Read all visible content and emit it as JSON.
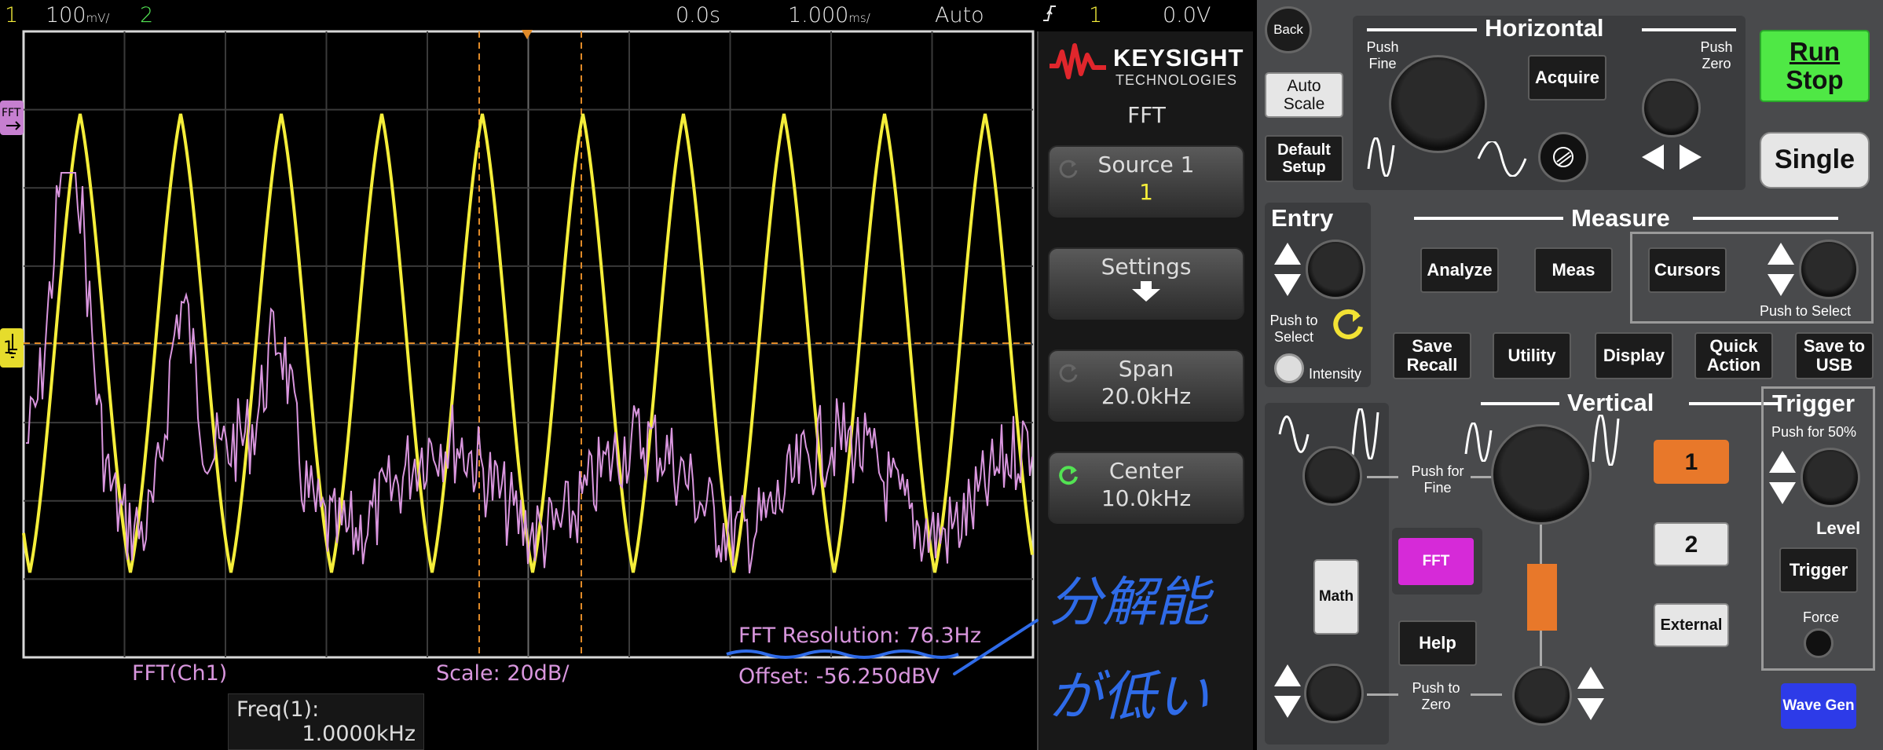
{
  "status_bar": {
    "ch1_number": "1",
    "ch1_scale": "100",
    "ch1_scale_unit": "mV/",
    "ch2_number": "2",
    "time_position": "0.0s",
    "time_scale": "1.000",
    "time_scale_unit": "ms/",
    "trigger_mode": "Auto",
    "trigger_edge_icon": "rising-edge-icon",
    "trigger_source": "1",
    "trigger_level": "0.0V"
  },
  "display": {
    "ch1_color": "#f5ee3a",
    "fft_color": "#d996de",
    "cursor_color": "#e08a28",
    "fft_marker": "FFT",
    "fft_resolution": "FFT Resolution: 76.3Hz",
    "fft_source": "FFT(Ch1)",
    "fft_scale": "Scale: 20dB/",
    "fft_offset": "Offset: -56.250dBV",
    "freq_title": "Freq(1):",
    "freq_value": "1.0000kHz"
  },
  "softkeys": {
    "brand": "KEYSIGHT",
    "brand_sub": "TECHNOLOGIES",
    "menu_title": "FFT",
    "source_label": "Source 1",
    "source_value": "1",
    "settings_label": "Settings",
    "span_label": "Span",
    "span_value": "20.0kHz",
    "center_label": "Center",
    "center_value": "10.0kHz"
  },
  "annotation": {
    "line1": "分解能",
    "line2": "が低い",
    "color": "#2f6be8"
  },
  "panel": {
    "back": "Back",
    "auto_scale": "Auto Scale",
    "default_setup": "Default Setup",
    "horizontal_title": "Horizontal",
    "push_fine": "Push Fine",
    "push_zero": "Push Zero",
    "acquire": "Acquire",
    "run_stop_1": "Run",
    "run_stop_2": "Stop",
    "run_stop_color": "#3fe03a",
    "single": "Single",
    "entry_title": "Entry",
    "push_to_select": "Push to Select",
    "intensity": "Intensity",
    "measure_title": "Measure",
    "analyze": "Analyze",
    "meas": "Meas",
    "cursors": "Cursors",
    "push_to_select_2": "Push to Select",
    "save_recall": "Save Recall",
    "utility": "Utility",
    "display": "Display",
    "quick_action": "Quick Action",
    "save_to_usb": "Save to USB",
    "vertical_title": "Vertical",
    "push_for_fine": "Push for Fine",
    "push_to_zero": "Push to Zero",
    "math": "Math",
    "fft": "FFT",
    "fft_color": "#d62ad8",
    "help": "Help",
    "ch1": "1",
    "ch1_button_color": "#e8782a",
    "ch2": "2",
    "external": "External",
    "trigger_title": "Trigger",
    "push_for_50": "Push for 50%",
    "level": "Level",
    "trigger_button": "Trigger",
    "force": "Force",
    "wavegen": "Wave Gen",
    "wavegen_color": "#2d3be8"
  }
}
